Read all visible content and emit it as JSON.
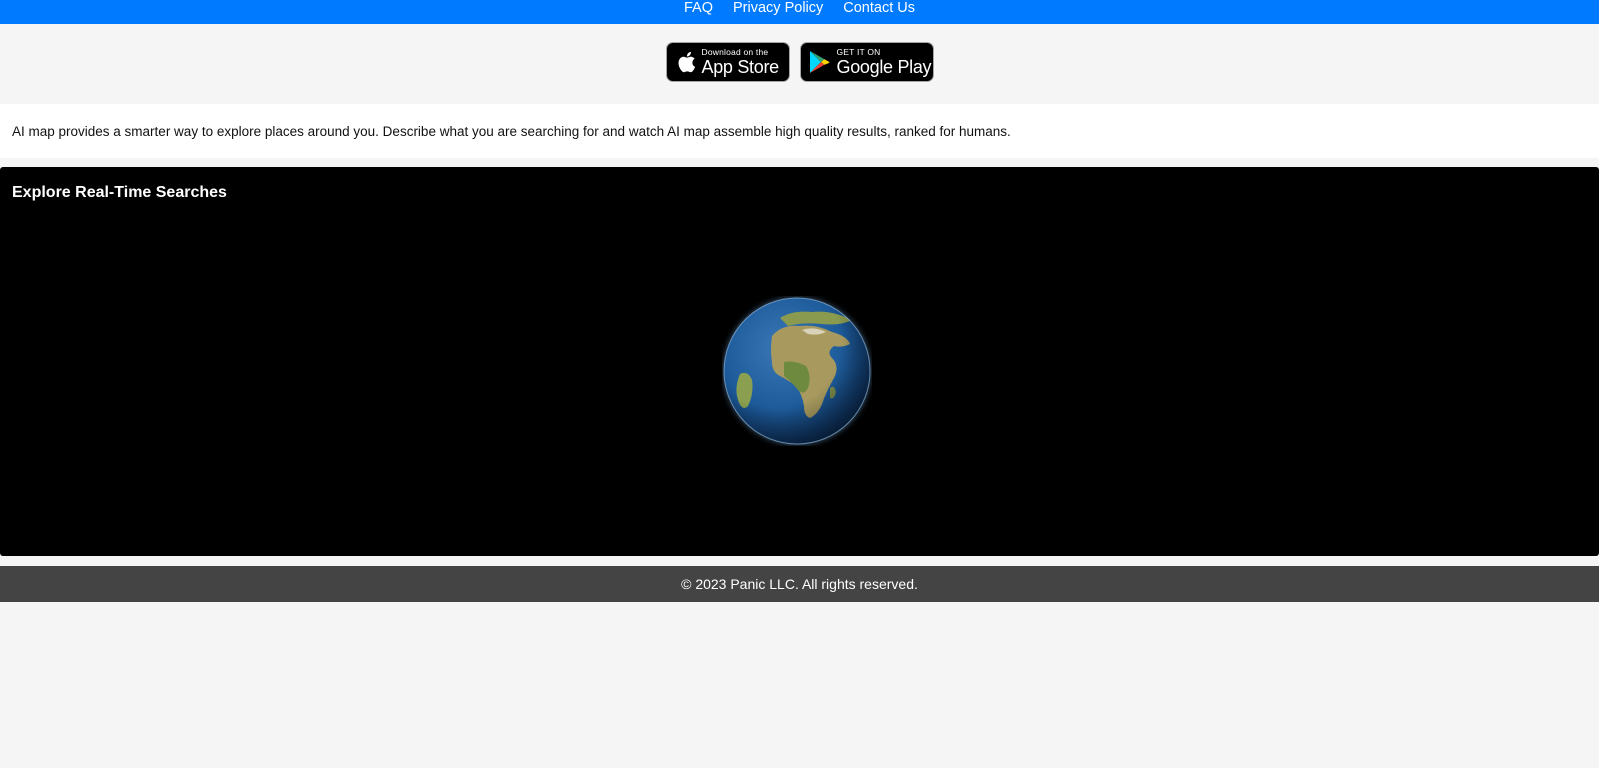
{
  "nav": {
    "links": [
      "FAQ",
      "Privacy Policy",
      "Contact Us"
    ]
  },
  "badges": {
    "apple": {
      "small": "Download on the",
      "big": "App Store"
    },
    "google": {
      "small": "GET IT ON",
      "big": "Google Play"
    }
  },
  "description": "AI map provides a smarter way to explore places around you. Describe what you are searching for and watch AI map assemble high quality results, ranked for humans.",
  "explore": {
    "title": "Explore Real-Time Searches"
  },
  "footer": {
    "copyright": "© 2023 Panic LLC. All rights reserved."
  },
  "colors": {
    "nav_bg": "#007bff",
    "footer_bg": "#444444",
    "explore_bg": "#000000",
    "page_bg": "#f5f5f5"
  },
  "icons": [
    "apple-icon",
    "google-play-icon",
    "globe-icon"
  ]
}
